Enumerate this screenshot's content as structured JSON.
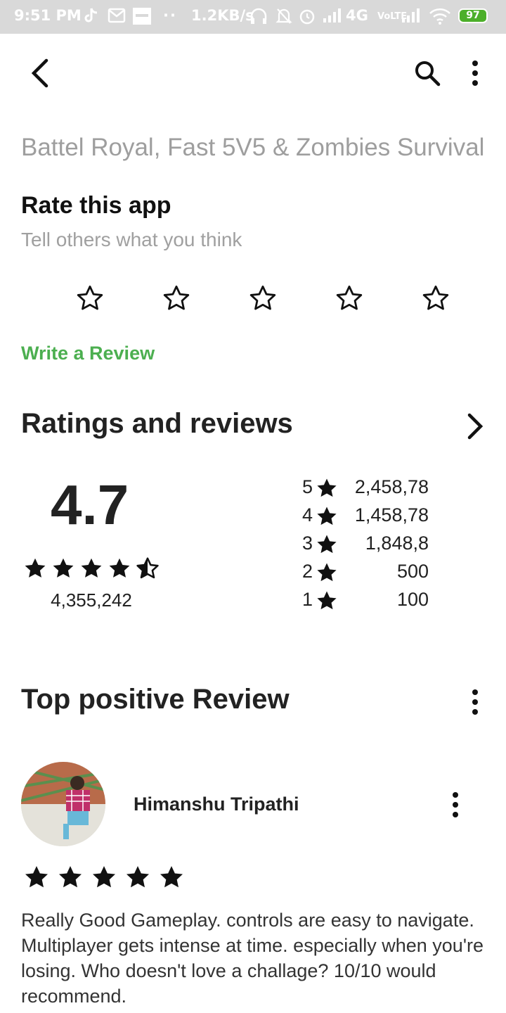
{
  "status_bar": {
    "time": "9:51 PM",
    "speed": "1.2KB/s",
    "network": "4G",
    "battery": "97"
  },
  "toolbar": {
    "back_icon": "back-arrow-icon",
    "search_icon": "search-icon",
    "menu_icon": "more-vert-icon"
  },
  "app": {
    "title": "Battel Royal, Fast 5V5 & Zombies Survival"
  },
  "rate": {
    "title": "Rate this app",
    "subtitle": "Tell others what you think",
    "stars": 5,
    "write_review": "Write a Review"
  },
  "ratings": {
    "title": "Ratings and reviews",
    "average": "4.7",
    "average_stars": 4.5,
    "total": "4,355,242",
    "distribution": [
      {
        "stars": "5",
        "count": "2,458,78"
      },
      {
        "stars": "4",
        "count": "1,458,78"
      },
      {
        "stars": "3",
        "count": "1,848,8"
      },
      {
        "stars": "2",
        "count": "500"
      },
      {
        "stars": "1",
        "count": "100"
      }
    ]
  },
  "top_review": {
    "title": "Top positive Review",
    "reviewer": "Himanshu Tripathi",
    "stars": 5,
    "text": "Really Good Gameplay. controls are easy to navigate. Multiplayer gets intense at time. especially when you're losing. Who doesn't love a challage? 10/10 would recommend."
  },
  "colors": {
    "accent": "#4caf50",
    "title_gray": "#9e9e9e",
    "status_bar": "#d9d9d9"
  }
}
